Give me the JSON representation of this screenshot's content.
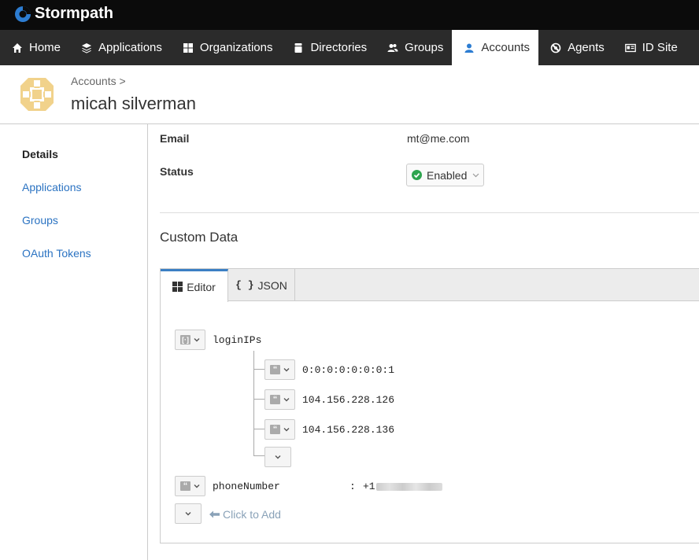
{
  "app": {
    "brand": "Stormpath"
  },
  "nav": {
    "items": [
      {
        "label": "Home",
        "icon": "home-icon"
      },
      {
        "label": "Applications",
        "icon": "layers-icon"
      },
      {
        "label": "Organizations",
        "icon": "grid-icon"
      },
      {
        "label": "Directories",
        "icon": "database-icon"
      },
      {
        "label": "Groups",
        "icon": "users-icon"
      },
      {
        "label": "Accounts",
        "icon": "user-icon",
        "active": true
      },
      {
        "label": "Agents",
        "icon": "agent-icon"
      },
      {
        "label": "ID Site",
        "icon": "id-card-icon"
      }
    ]
  },
  "header": {
    "breadcrumb": "Accounts >",
    "title": "micah silverman"
  },
  "sidebar": {
    "items": [
      {
        "label": "Details",
        "active": true
      },
      {
        "label": "Applications"
      },
      {
        "label": "Groups"
      },
      {
        "label": "OAuth Tokens"
      }
    ]
  },
  "details": {
    "email_label": "Email",
    "email_value": "mt@me.com",
    "status_label": "Status",
    "status_value": "Enabled"
  },
  "custom_data": {
    "title": "Custom Data",
    "tabs": {
      "editor": "Editor",
      "json": "JSON",
      "json_glyph": "{ }"
    },
    "entries": {
      "login_key": "loginIPs",
      "login_values": [
        "0:0:0:0:0:0:0:1",
        "104.156.228.126",
        "104.156.228.136"
      ],
      "phone_key": "phoneNumber",
      "phone_sep": ":",
      "phone_value": "+1"
    },
    "add_label": "Click to Add"
  },
  "colors": {
    "accent": "#3b7fc4",
    "link": "#2b73c2",
    "nav_bg": "#2b2b2b",
    "enabled": "#2ea44f"
  }
}
